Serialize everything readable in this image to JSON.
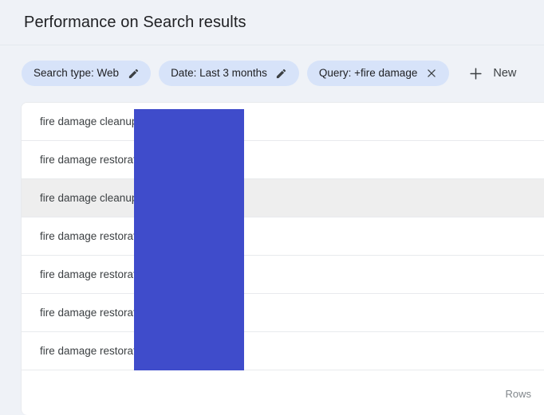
{
  "header": {
    "title": "Performance on Search results"
  },
  "filters": {
    "chips": [
      {
        "label": "Search type: Web",
        "icon": "pencil-icon",
        "action": "edit"
      },
      {
        "label": "Date: Last 3 months",
        "icon": "pencil-icon",
        "action": "edit"
      },
      {
        "label": "Query: +fire damage",
        "icon": "close-icon",
        "action": "remove"
      }
    ],
    "new_button": {
      "label": "New",
      "icon": "plus-icon"
    }
  },
  "table": {
    "rows": [
      {
        "query": "fire damage cleanup",
        "highlighted": false
      },
      {
        "query": "fire damage restorat",
        "highlighted": false
      },
      {
        "query": "fire damage cleanup",
        "highlighted": true
      },
      {
        "query": "fire damage restorat",
        "highlighted": false
      },
      {
        "query": "fire damage restorat",
        "highlighted": false
      },
      {
        "query": "fire damage restorat",
        "highlighted": false
      },
      {
        "query": "fire damage restorat",
        "highlighted": false
      }
    ],
    "footer": {
      "rows_label": "Rows"
    }
  },
  "colors": {
    "page_background": "#eff2f7",
    "chip_background": "#d7e3f9",
    "overlay_block": "#3f4ccb",
    "row_highlight": "#eeeeee",
    "text_primary": "#202124",
    "text_secondary": "#3c4043",
    "text_muted": "#80868b"
  }
}
